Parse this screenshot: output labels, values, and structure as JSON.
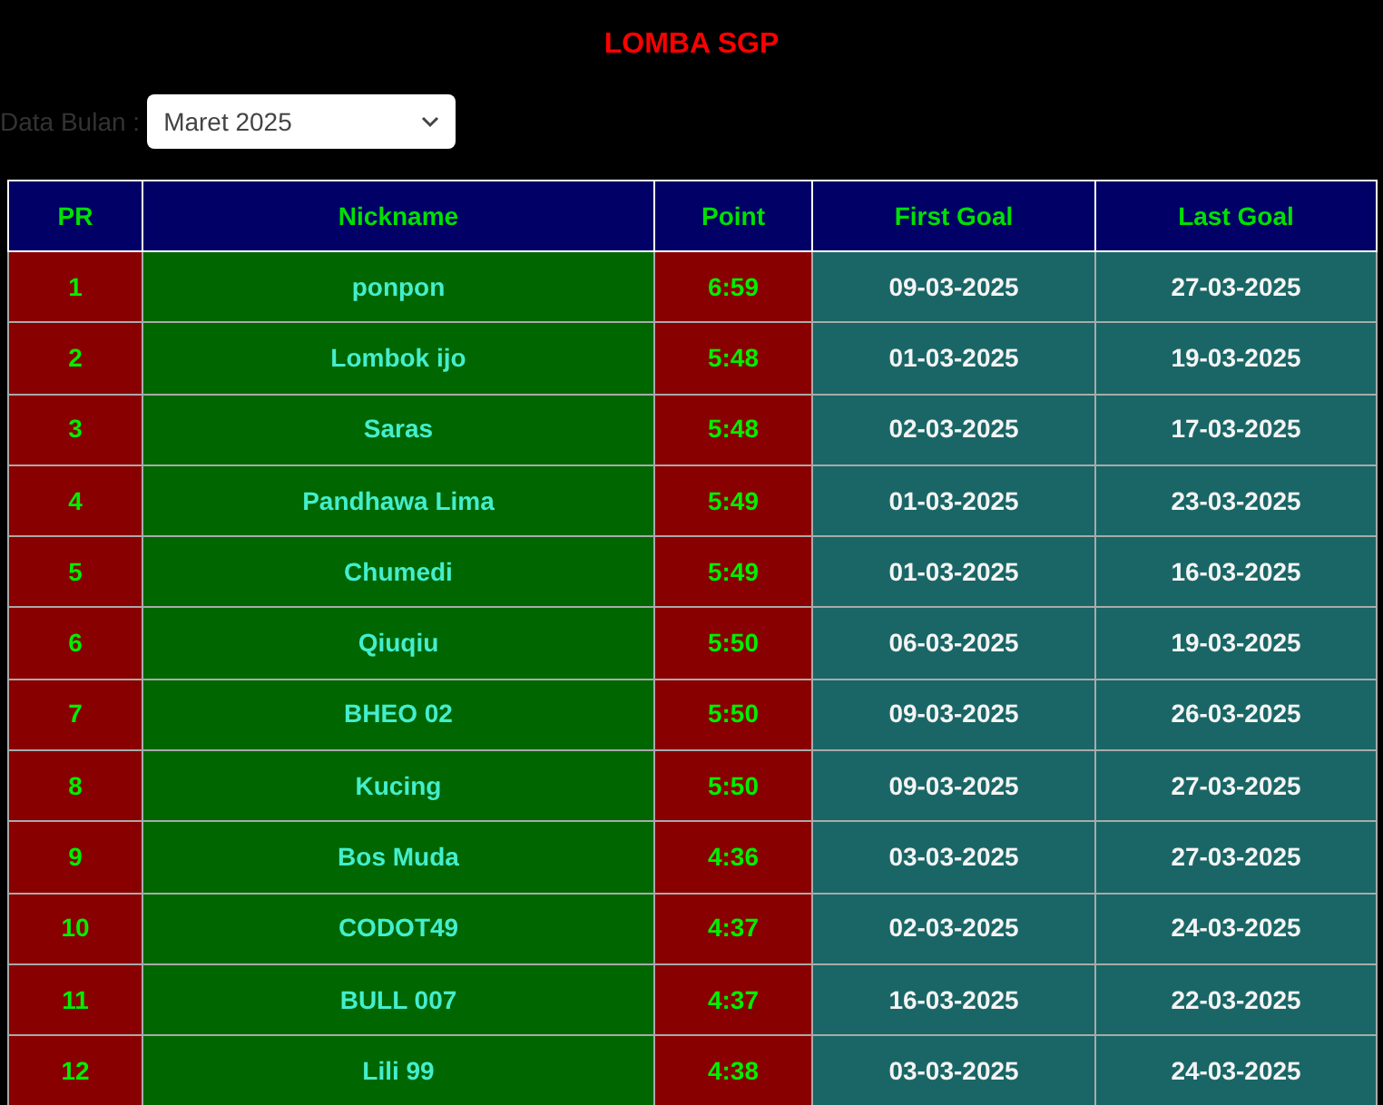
{
  "title": "LOMBA SGP",
  "filter": {
    "label": "Data Bulan :",
    "value": "Maret 2025"
  },
  "table": {
    "columns": [
      "PR",
      "Nickname",
      "Point",
      "First Goal",
      "Last Goal"
    ],
    "rows": [
      [
        "1",
        "ponpon",
        "6:59",
        "09-03-2025",
        "27-03-2025"
      ],
      [
        "2",
        "Lombok ijo",
        "5:48",
        "01-03-2025",
        "19-03-2025"
      ],
      [
        "3",
        "Saras",
        "5:48",
        "02-03-2025",
        "17-03-2025"
      ],
      [
        "4",
        "Pandhawa Lima",
        "5:49",
        "01-03-2025",
        "23-03-2025"
      ],
      [
        "5",
        "Chumedi",
        "5:49",
        "01-03-2025",
        "16-03-2025"
      ],
      [
        "6",
        "Qiuqiu",
        "5:50",
        "06-03-2025",
        "19-03-2025"
      ],
      [
        "7",
        "BHEO 02",
        "5:50",
        "09-03-2025",
        "26-03-2025"
      ],
      [
        "8",
        "Kucing",
        "5:50",
        "09-03-2025",
        "27-03-2025"
      ],
      [
        "9",
        "Bos Muda",
        "4:36",
        "03-03-2025",
        "27-03-2025"
      ],
      [
        "10",
        "CODOT49",
        "4:37",
        "02-03-2025",
        "24-03-2025"
      ],
      [
        "11",
        "BULL 007",
        "4:37",
        "16-03-2025",
        "22-03-2025"
      ],
      [
        "12",
        "Lili 99",
        "4:38",
        "03-03-2025",
        "24-03-2025"
      ]
    ]
  }
}
